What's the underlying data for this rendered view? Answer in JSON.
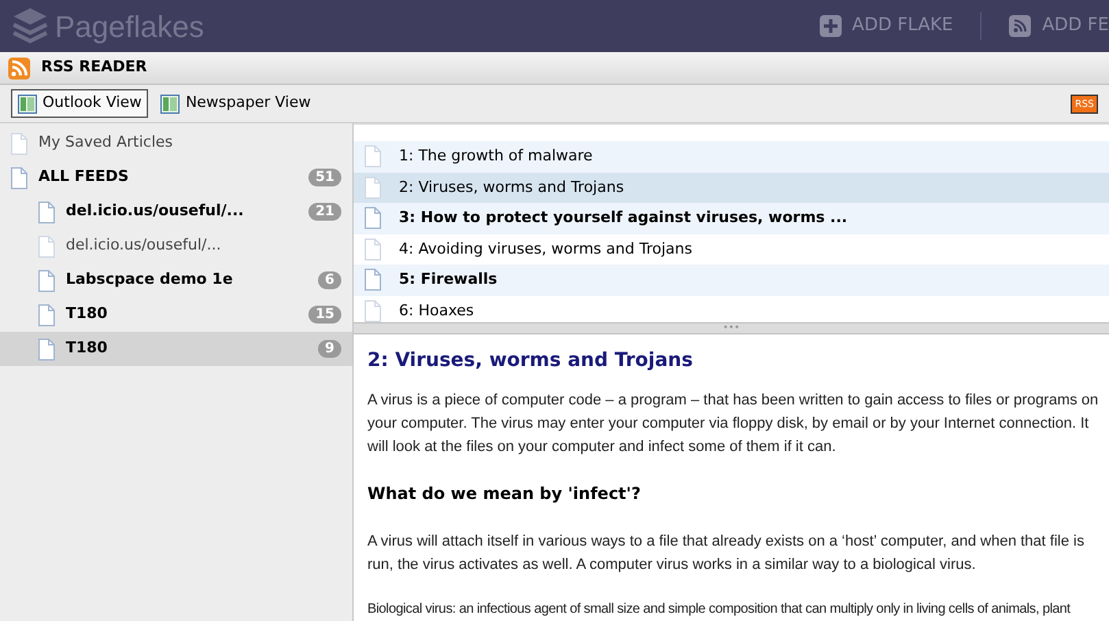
{
  "header": {
    "logo": "Pageflakes",
    "actions": [
      {
        "kind": "add",
        "label": "ADD FLAKE"
      },
      {
        "kind": "feed",
        "label": "ADD FE"
      }
    ]
  },
  "flake": {
    "title": "RSS READER"
  },
  "views": [
    {
      "label": "Outlook View",
      "selected": true
    },
    {
      "label": "Newspaper View",
      "selected": false
    }
  ],
  "rss_badge": "RSS",
  "feeds": [
    {
      "label": "My Saved Articles",
      "unread": false,
      "selected": false
    },
    {
      "label": "ALL FEEDS",
      "count": "51",
      "unread": true,
      "selected": false,
      "children": [
        {
          "label": "del.icio.us/ouseful/...",
          "count": "21",
          "unread": true,
          "selected": false
        },
        {
          "label": "del.icio.us/ouseful/...",
          "unread": false,
          "selected": false
        },
        {
          "label": "Labscpace demo 1e",
          "count": "6",
          "unread": true,
          "selected": false
        },
        {
          "label": "T180",
          "count": "15",
          "unread": true,
          "selected": false
        },
        {
          "label": "T180",
          "count": "9",
          "unread": true,
          "selected": true
        }
      ]
    }
  ],
  "articles": [
    {
      "title": "1: The growth of malware",
      "unread": false,
      "selected": false
    },
    {
      "title": "2: Viruses, worms and Trojans",
      "unread": false,
      "selected": true
    },
    {
      "title": "3: How to protect yourself against viruses, worms ...",
      "unread": true,
      "selected": false
    },
    {
      "title": "4: Avoiding viruses, worms and Trojans",
      "unread": false,
      "selected": false
    },
    {
      "title": "5: Firewalls",
      "unread": true,
      "selected": false
    },
    {
      "title": "6: Hoaxes",
      "unread": false,
      "selected": false
    }
  ],
  "splitter": "•••",
  "reader": {
    "title": "2: Viruses, worms and Trojans",
    "blocks": [
      {
        "kind": "paragraph",
        "text": "A virus is a piece of computer code – a program – that has been written to gain access to files or programs on your computer. The virus may enter your computer via floppy disk, by email or by your Internet connection. It will look at the files on your computer and infect some of them if it can."
      },
      {
        "kind": "heading",
        "text": "What do we mean by 'infect'?"
      },
      {
        "kind": "paragraph",
        "text": "A virus will attach itself in various ways to a file that already exists on a ‘host’ computer, and when that file is run, the virus activates as well. A computer virus works in a similar way to a biological virus."
      },
      {
        "kind": "cutline",
        "text": "Biological virus: an infectious agent of small size and simple composition that can multiply only in living cells of animals, plant"
      }
    ]
  }
}
